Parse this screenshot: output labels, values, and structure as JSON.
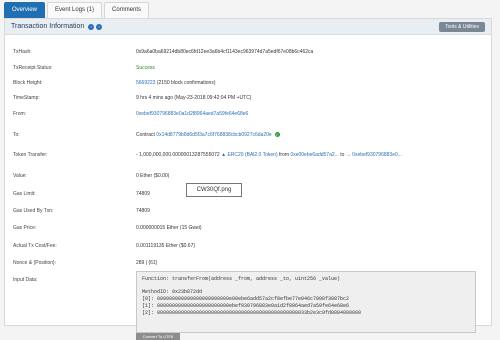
{
  "tabs": [
    "Overview",
    "Event Logs (1)",
    "Comments"
  ],
  "header": {
    "title": "Transaction Information",
    "tools_label": "Tools & Utilities"
  },
  "rows": {
    "tx_hash": {
      "label": "TxHash:",
      "value": "0x9a6a0ba69214db80ec6fd12ee3a6b4cf1143ec963974d7a5edf67e08b6c462ca"
    },
    "receipt_status": {
      "label": "TxReceipt Status:",
      "value": "Success"
    },
    "block_height": {
      "label": "Block Height:",
      "value_link": "5669223",
      "value_rest": " (2150 block confirmations)"
    },
    "timestamp": {
      "label": "TimeStamp:",
      "value": "9 hrs 4 mins ago (May-23-2018 09:42:04 PM +UTC)"
    },
    "from": {
      "label": "From:",
      "value": "0xebef930796883e0a1d2f8964aed7a59fe64e68e6"
    },
    "to": {
      "label": "To:",
      "prefix": "Contract ",
      "value": "0x14d8779b8d6d5f3a7c6f768838cbcb0927c6da20e"
    },
    "token_transfer": {
      "label": "Token Transfer:",
      "amount": "- 1,000,000,000.00000013287555072",
      "token": "ERC20 (BAl2.0 Token)",
      "from_label": "from",
      "from_addr": "0xe00ebe6add57a2...",
      "to_label": "to",
      "to_addr": "0xebef930796883e0..."
    },
    "value": {
      "label": "Value:",
      "value": "0 Ether ($0.00)"
    },
    "gas_limit": {
      "label": "Gas Limit:",
      "value": "74809"
    },
    "gas_used": {
      "label": "Gas Used By Txn:",
      "value": "74809"
    },
    "gas_price": {
      "label": "Gas Price:",
      "value": "0.000000015 Ether (15 Gwei)"
    },
    "actual_fee": {
      "label": "Actual Tx Cost/Fee:",
      "value": "0.001119135 Ether ($0.67)"
    },
    "nonce": {
      "label": "Nonce & {Position}:",
      "value": "289 | {61}"
    },
    "input_data": {
      "label": "Input Data:"
    }
  },
  "tooltip": "CW30Qf.png",
  "input_data": {
    "function": "Function: transferFrom(address _from, address _to, uint256 _value)",
    "method_id": "MethodID: 0x23b872dd",
    "params": [
      "[0]:  000000000000000000000000e00ebe6add57a2cf8efbe77e046c7008f3087bc2",
      "[1]:  000000000000000000000000ebef930796883e0a1d2f8964aed7a59fe64e68e6",
      "[2]:  00000000000000000000000000000000000000000000000033b2e3c9fd0804000000"
    ]
  },
  "convert_button": "Convert To UTF8"
}
